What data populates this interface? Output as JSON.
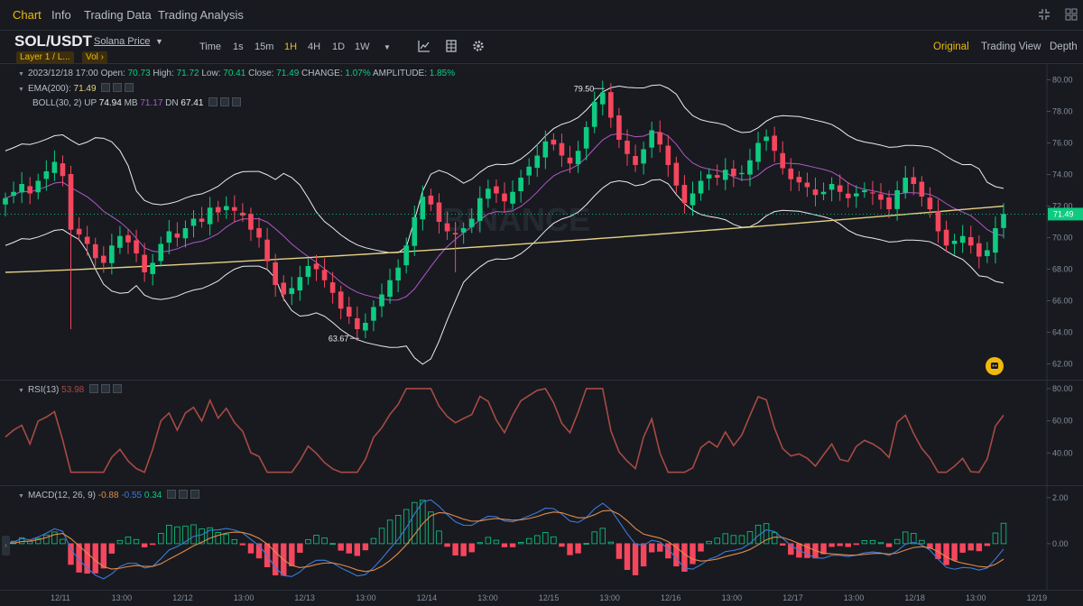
{
  "tabs": [
    "Chart",
    "Info",
    "Trading Data",
    "Trading Analysis"
  ],
  "active_tab": "Chart",
  "symbol": "SOL/USDT",
  "symbol_sub": "Solana Price",
  "tags": {
    "category": "Layer 1 / L...",
    "vol": "Vol ›"
  },
  "intervals": [
    "Time",
    "1s",
    "15m",
    "1H",
    "4H",
    "1D",
    "1W"
  ],
  "active_interval": "1H",
  "views": [
    "Original",
    "Trading View",
    "Depth"
  ],
  "active_view": "Original",
  "ohlc": {
    "date": "2023/12/18 17:00",
    "open_label": "Open:",
    "open": "70.73",
    "high_label": "High:",
    "high": "71.72",
    "low_label": "Low:",
    "low": "70.41",
    "close_label": "Close:",
    "close": "71.49",
    "change_label": "CHANGE:",
    "change": "1.07%",
    "amp_label": "AMPLITUDE:",
    "amp": "1.85%"
  },
  "ema": {
    "label": "EMA(200):",
    "value": "71.49"
  },
  "boll": {
    "label": "BOLL(30, 2)",
    "up_label": "UP",
    "up": "74.94",
    "mb_label": "MB",
    "mb": "71.17",
    "dn_label": "DN",
    "dn": "67.41"
  },
  "rsi": {
    "label": "RSI(13)",
    "value": "53.98"
  },
  "macd": {
    "label": "MACD(12, 26, 9)",
    "v1": "-0.88",
    "v2": "-0.55",
    "v3": "0.34"
  },
  "watermark": "BINANCE",
  "price_axis": [
    "80.00",
    "78.00",
    "76.00",
    "74.00",
    "72.00",
    "70.00",
    "68.00",
    "66.00",
    "64.00",
    "62.00"
  ],
  "current_price": "71.49",
  "annotations": {
    "high": "79.50",
    "low": "63.67"
  },
  "rsi_axis": [
    "80.00",
    "60.00",
    "40.00"
  ],
  "macd_axis": [
    "2.00",
    "0.00"
  ],
  "dates": [
    "12/11",
    "13:00",
    "12/12",
    "13:00",
    "12/13",
    "13:00",
    "12/14",
    "13:00",
    "12/15",
    "13:00",
    "12/16",
    "13:00",
    "12/17",
    "13:00",
    "12/18",
    "13:00",
    "12/19"
  ],
  "colors": {
    "up": "#0ecb81",
    "down": "#f6465d",
    "accent": "#f0b90b",
    "ema": "#e5d183",
    "boll_mb": "#b158c7",
    "boll_band": "#eaecef",
    "rsi": "#a84a43",
    "dif": "#3b7bd8",
    "dea": "#e18a4a"
  },
  "chart_data": {
    "type": "candlestick",
    "price_series_close": [
      72.5,
      72.9,
      73.4,
      72.8,
      73.6,
      74.2,
      74.8,
      73.9,
      70.5,
      70.2,
      69.6,
      68.7,
      68.4,
      69.5,
      70.1,
      69.7,
      69.0,
      67.8,
      68.4,
      69.6,
      70.4,
      70.0,
      70.6,
      71.2,
      71.0,
      71.9,
      71.6,
      72.0,
      71.7,
      71.4,
      70.5,
      70.0,
      68.5,
      67.0,
      66.4,
      66.8,
      67.5,
      68.2,
      68.0,
      67.3,
      66.5,
      65.5,
      65.0,
      64.2,
      64.6,
      65.6,
      66.4,
      67.3,
      68.1,
      69.5,
      71.3,
      72.6,
      72.1,
      71.0,
      70.4,
      70.2,
      70.6,
      71.2,
      72.5,
      73.1,
      72.8,
      72.3,
      72.9,
      73.8,
      74.5,
      75.2,
      76.1,
      75.9,
      75.2,
      74.7,
      75.5,
      77.0,
      78.6,
      79.2,
      77.6,
      76.2,
      75.3,
      74.6,
      75.6,
      76.8,
      75.9,
      74.6,
      73.3,
      72.2,
      72.8,
      73.6,
      74.0,
      73.8,
      74.3,
      73.9,
      74.1,
      74.9,
      76.0,
      76.4,
      75.5,
      74.4,
      73.7,
      73.5,
      73.2,
      72.7,
      72.9,
      73.4,
      72.9,
      72.5,
      72.8,
      73.0,
      72.8,
      72.4,
      71.8,
      73.0,
      73.8,
      73.4,
      72.6,
      71.8,
      70.4,
      69.5,
      69.8,
      70.1,
      69.5,
      68.8,
      69.2,
      70.6,
      71.5
    ],
    "y_range": [
      61,
      81
    ],
    "annotations": {
      "high": 79.5,
      "low": 63.67
    },
    "ema200_approx": [
      67.8,
      72.0
    ],
    "boll_approx": {
      "up": 74.94,
      "mb": 71.17,
      "dn": 67.41
    },
    "rsi_approx": [
      53,
      40,
      70,
      35,
      75,
      78,
      40,
      60,
      35,
      54
    ],
    "rsi_range": [
      20,
      85
    ],
    "macd_range": [
      -2.0,
      2.5
    ]
  }
}
